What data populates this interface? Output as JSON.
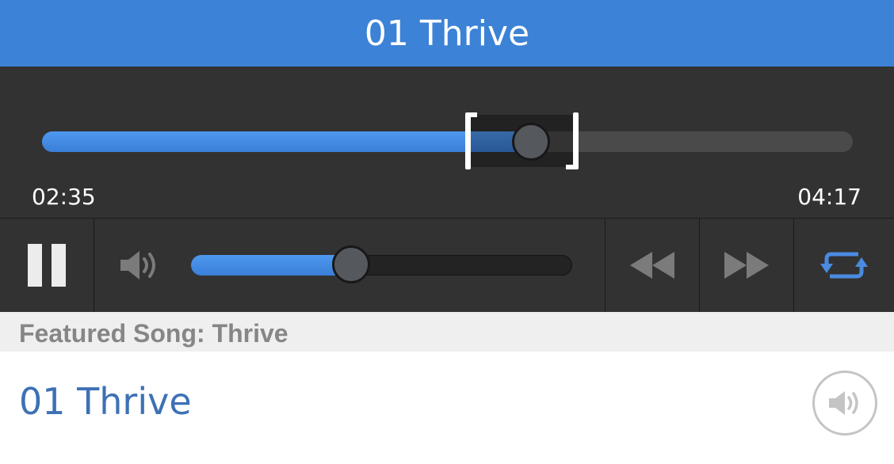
{
  "header": {
    "title": "01 Thrive"
  },
  "player": {
    "elapsed": "02:35",
    "duration": "04:17",
    "progress_fraction": 0.603,
    "loop_start_fraction": 0.523,
    "loop_end_fraction": 0.66,
    "volume_fraction": 0.42,
    "accent_color": "#3c82d6"
  },
  "controls": {
    "pause_icon": "pause-icon",
    "volume_icon": "speaker-icon",
    "rewind_icon": "rewind-icon",
    "fast_forward_icon": "fast-forward-icon",
    "repeat_icon": "repeat-icon"
  },
  "section": {
    "label": "Featured Song: Thrive"
  },
  "list": [
    {
      "title": "01 Thrive",
      "action_icon": "speaker-icon"
    }
  ]
}
